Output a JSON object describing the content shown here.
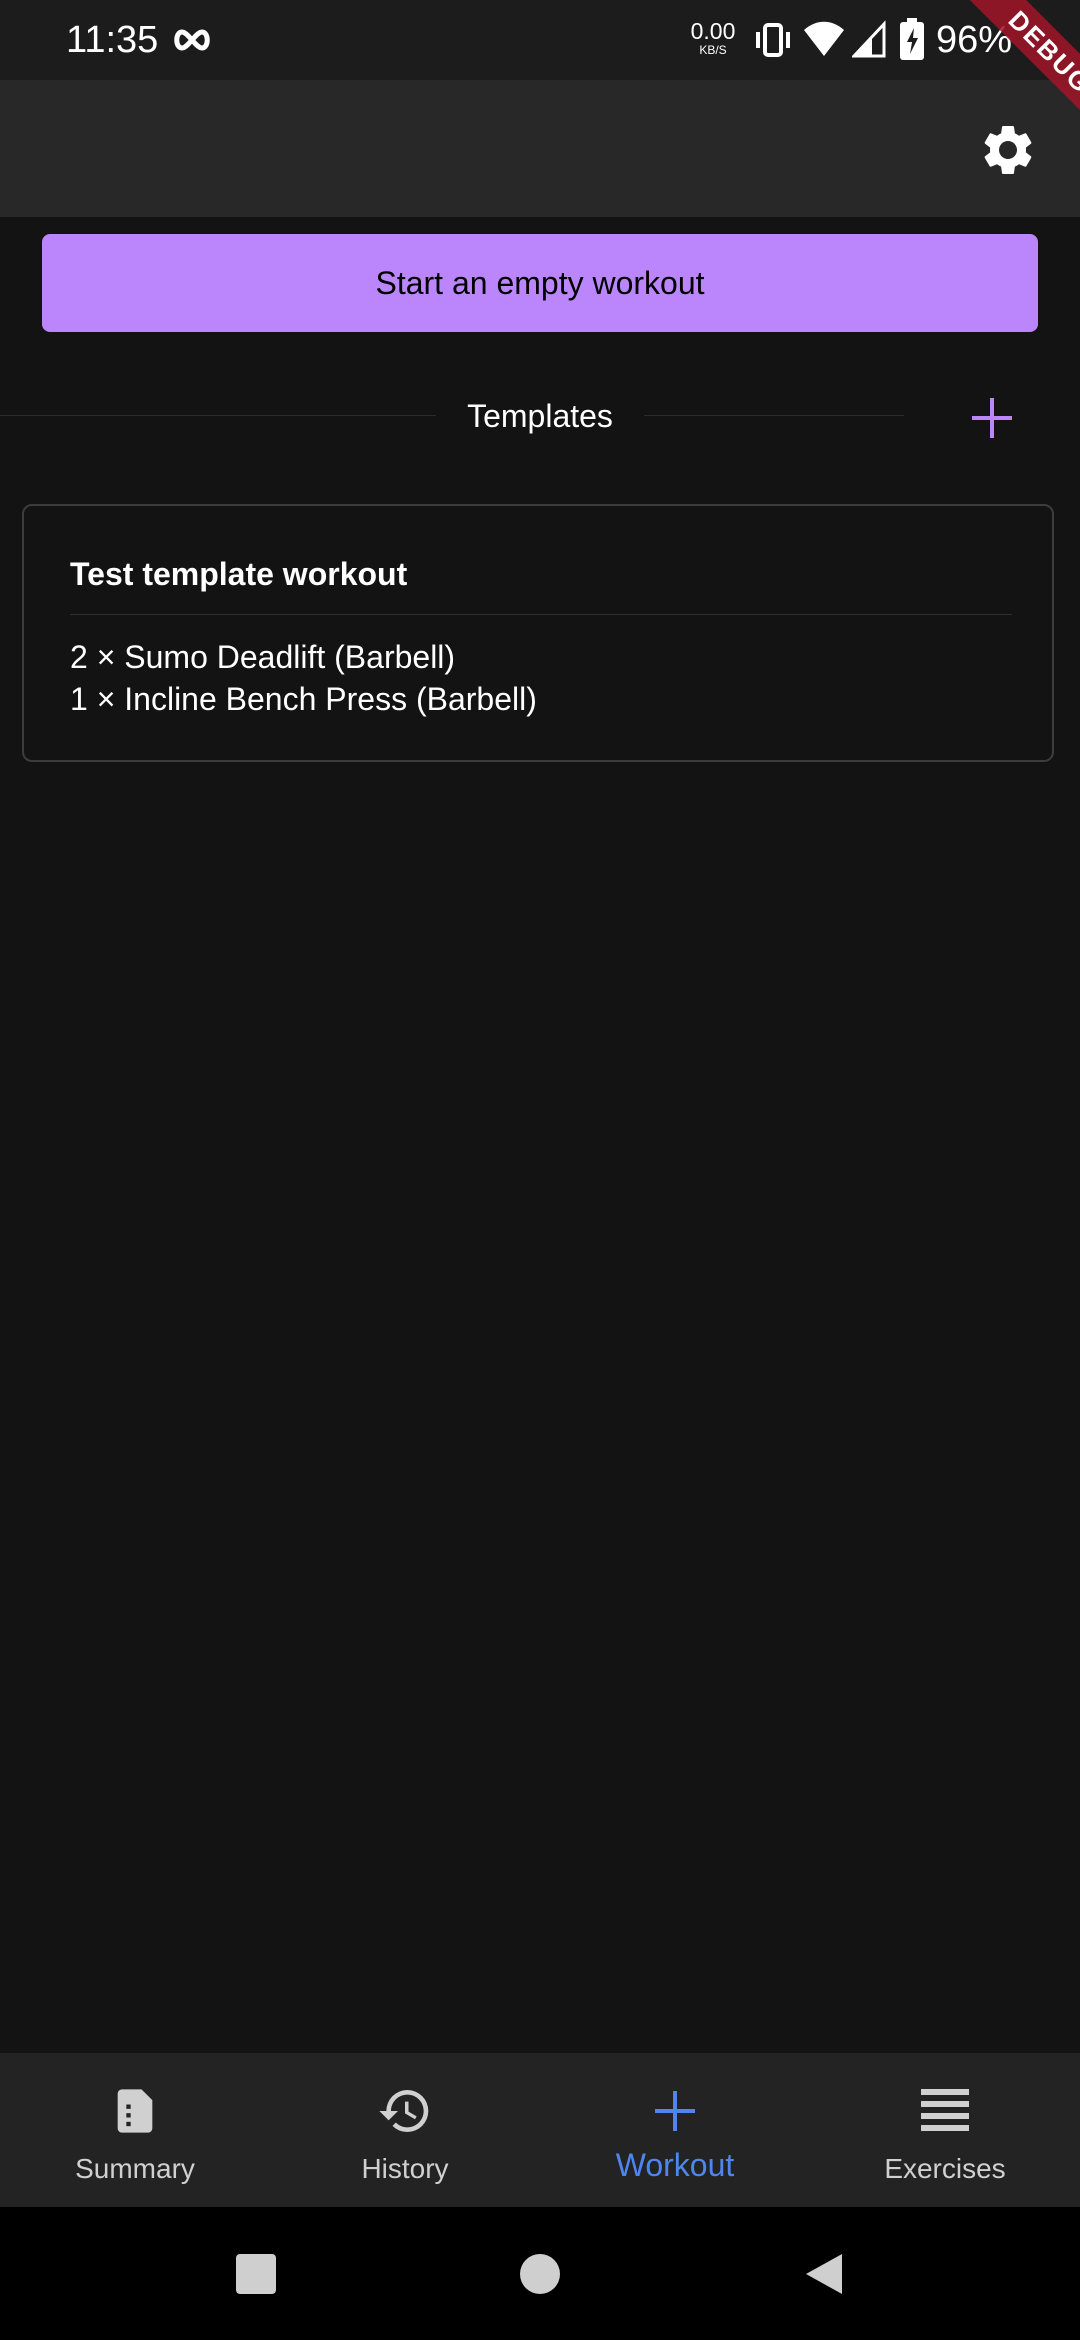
{
  "status_bar": {
    "time": "11:35",
    "net_speed_value": "0.00",
    "net_speed_unit": "KB/S",
    "battery_percent": "96%",
    "icons": [
      "infinity-icon",
      "vibrate-icon",
      "wifi-icon",
      "signal-icon",
      "battery-charging-icon"
    ]
  },
  "debug_banner": "DEBUG",
  "app_bar": {
    "settings_icon": "gear-icon"
  },
  "start_button": {
    "label": "Start an empty workout",
    "background": "#bb86fc"
  },
  "templates": {
    "header": "Templates",
    "add_icon": "plus-icon",
    "items": [
      {
        "title": "Test template workout",
        "exercises": [
          "2 × Sumo Deadlift (Barbell)",
          "1 × Incline Bench Press (Barbell)"
        ]
      }
    ]
  },
  "bottom_nav": {
    "active_color": "#4e86f0",
    "items": [
      {
        "label": "Summary",
        "icon": "document-icon",
        "active": false
      },
      {
        "label": "History",
        "icon": "history-icon",
        "active": false
      },
      {
        "label": "Workout",
        "icon": "plus-icon",
        "active": true
      },
      {
        "label": "Exercises",
        "icon": "list-icon",
        "active": false
      }
    ]
  },
  "system_nav": {
    "buttons": [
      "recents-button",
      "home-button",
      "back-button"
    ]
  }
}
